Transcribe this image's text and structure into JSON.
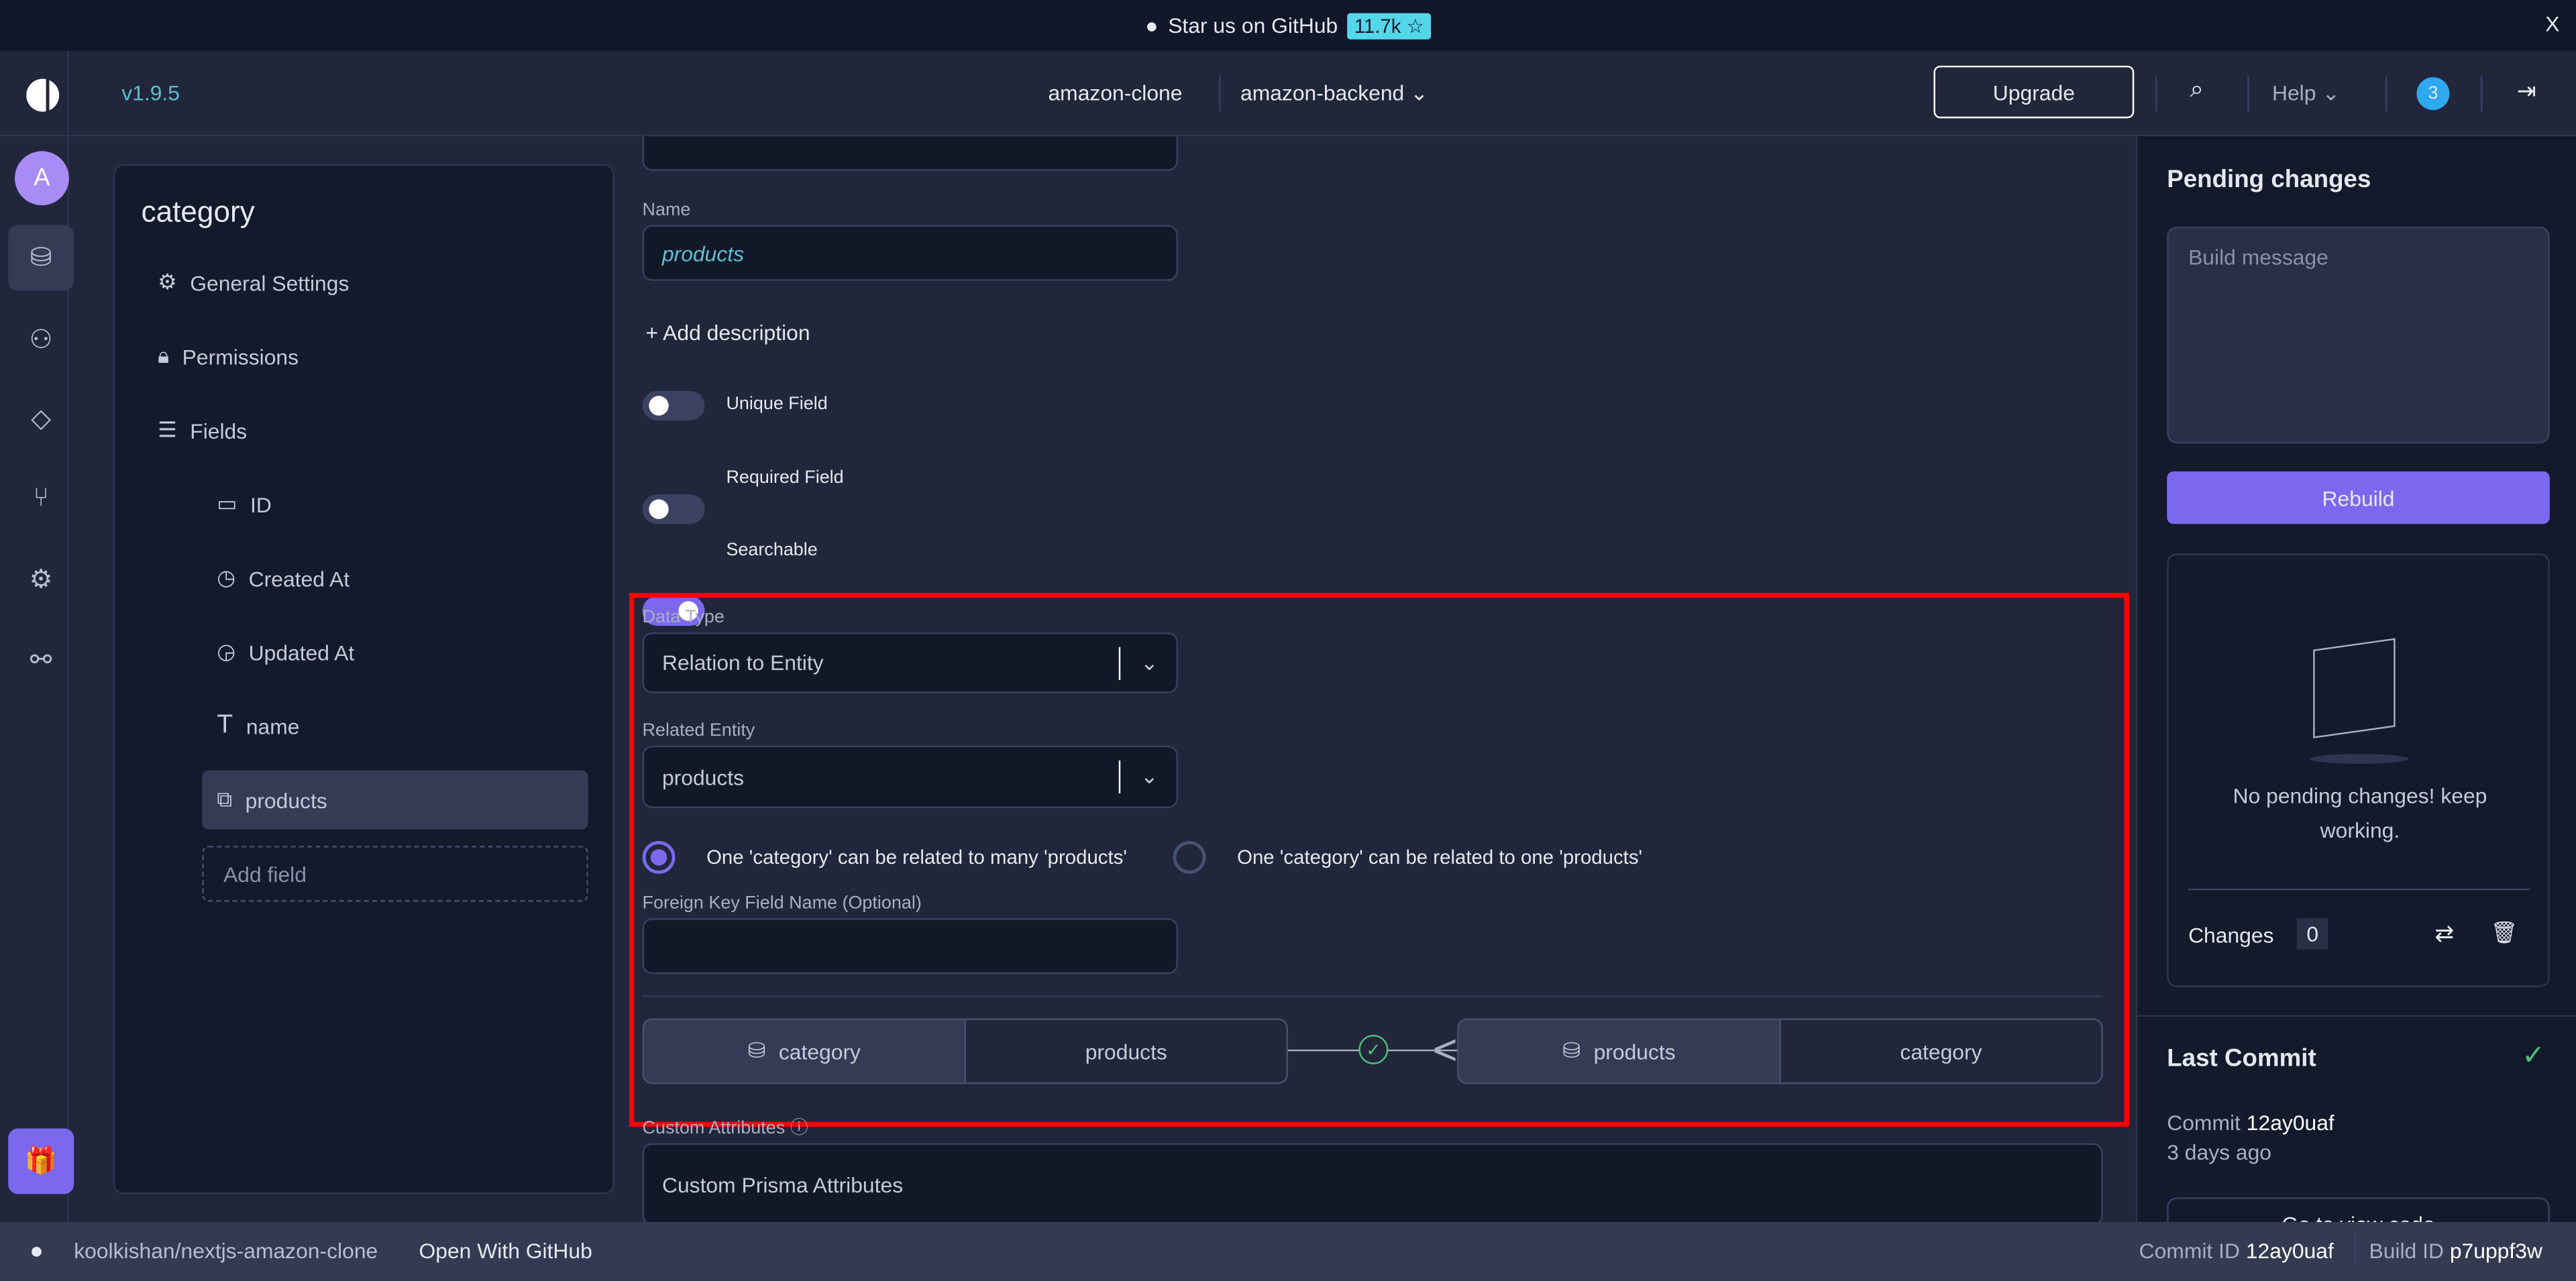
{
  "banner": {
    "text": "Star us on GitHub",
    "stars": "11.7k ☆",
    "close": "X"
  },
  "header": {
    "version": "v1.9.5",
    "project": "amazon-clone",
    "service": "amazon-backend",
    "upgrade": "Upgrade",
    "help": "Help",
    "notifications": "3"
  },
  "rail": {
    "avatar": "A"
  },
  "entity": {
    "title": "category",
    "nav": [
      {
        "label": "General Settings",
        "icon": "gear-icon"
      },
      {
        "label": "Permissions",
        "icon": "lock-icon"
      },
      {
        "label": "Fields",
        "icon": "list-icon"
      }
    ],
    "fields": [
      {
        "label": "ID",
        "icon": "id-card-icon"
      },
      {
        "label": "Created At",
        "icon": "clock-icon"
      },
      {
        "label": "Updated At",
        "icon": "clock-refresh-icon"
      },
      {
        "label": "name",
        "icon": "text-icon"
      },
      {
        "label": "products",
        "icon": "relation-icon"
      }
    ],
    "add_field": "Add field"
  },
  "form": {
    "name_label": "Name",
    "name_value": "products",
    "add_description": "+ Add description",
    "unique": "Unique Field",
    "required": "Required Field",
    "searchable": "Searchable",
    "toggles": {
      "unique": false,
      "required": false,
      "searchable": true
    },
    "data_type_label": "Data Type",
    "data_type": "Relation to Entity",
    "related_label": "Related Entity",
    "related": "products",
    "radio_many": "One 'category' can be related to many 'products'",
    "radio_one": "One 'category' can be related to one 'products'",
    "selected_radio": "many",
    "fk_label": "Foreign Key Field Name (Optional)",
    "fk_value": "",
    "relation": {
      "left_entity": "category",
      "left_field": "products",
      "right_entity": "products",
      "right_field": "category"
    },
    "custom_label": "Custom Attributes",
    "custom_placeholder": "Custom Prisma Attributes"
  },
  "pending": {
    "title": "Pending changes",
    "placeholder": "Build message",
    "rebuild": "Rebuild",
    "empty": "No pending changes! keep working.",
    "changes_label": "Changes",
    "changes_count": "0"
  },
  "commit": {
    "title": "Last Commit",
    "commit_label": "Commit",
    "commit_id": "12ay0uaf",
    "ago": "3 days ago",
    "view_code": "Go to view code"
  },
  "bottom": {
    "repo": "koolkishan/nextjs-amazon-clone",
    "open": "Open With GitHub",
    "commit_label": "Commit ID",
    "commit_id": "12ay0uaf",
    "build_label": "Build ID",
    "build_id": "p7uppf3w"
  },
  "colors": {
    "accent": "#7b68ee",
    "highlight": "#ff0000",
    "version": "#5bc0d0",
    "success": "#4cc07a"
  }
}
